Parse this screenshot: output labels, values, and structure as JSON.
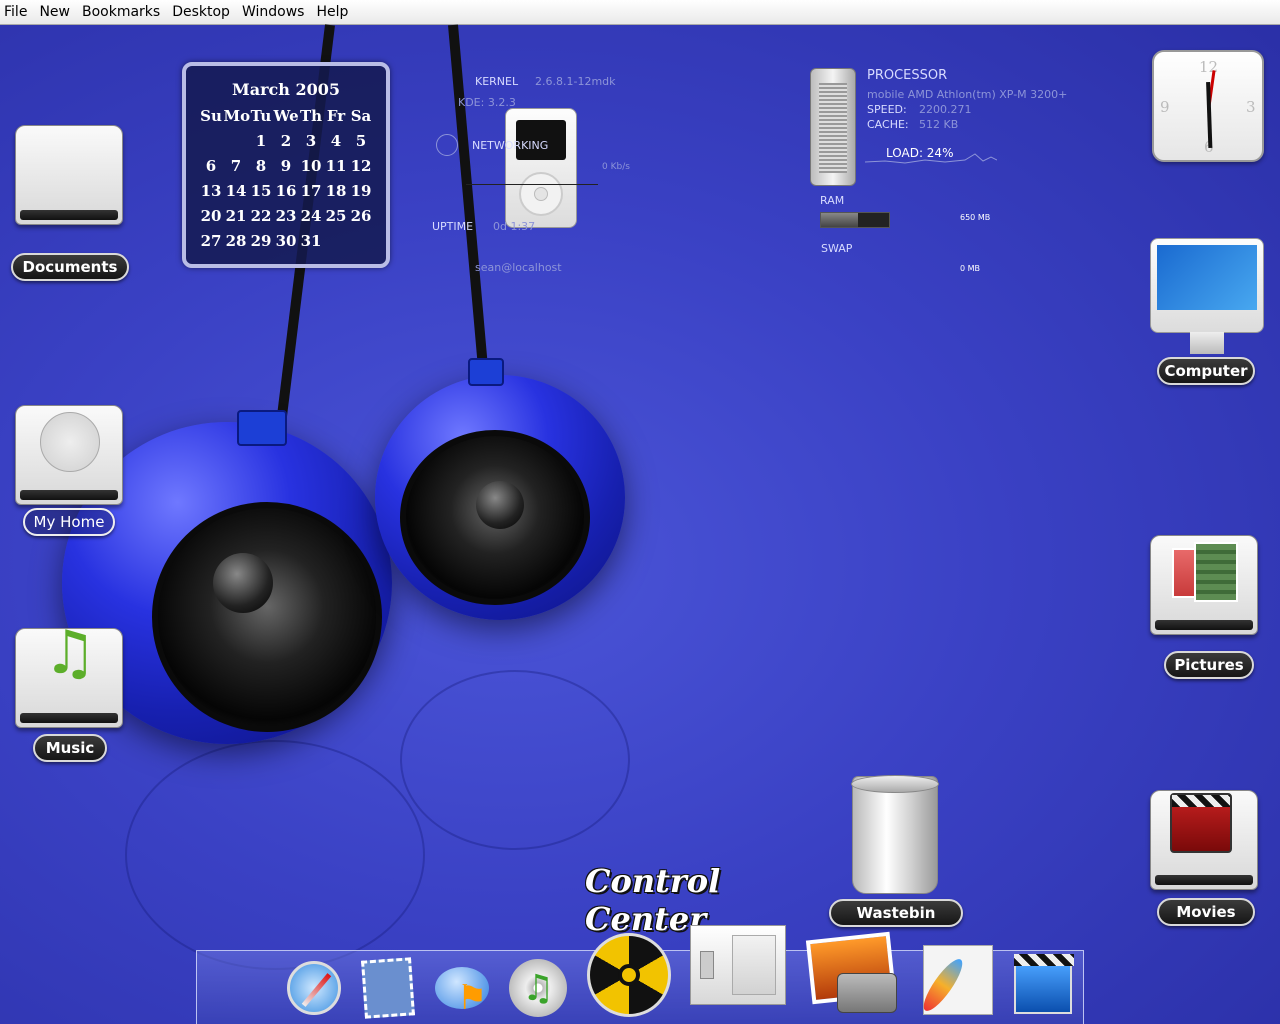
{
  "menubar": {
    "items": [
      "File",
      "New",
      "Bookmarks",
      "Desktop",
      "Windows",
      "Help"
    ]
  },
  "calendar": {
    "title": "March 2005",
    "weekdays": [
      "Su",
      "Mo",
      "Tu",
      "We",
      "Th",
      "Fr",
      "Sa"
    ],
    "rows": [
      [
        "",
        "",
        "1",
        "2",
        "3",
        "4",
        "5"
      ],
      [
        "6",
        "7",
        "8",
        "9",
        "10",
        "11",
        "12"
      ],
      [
        "13",
        "14",
        "15",
        "16",
        "17",
        "18",
        "19"
      ],
      [
        "20",
        "21",
        "22",
        "23",
        "24",
        "25",
        "26"
      ],
      [
        "27",
        "28",
        "29",
        "30",
        "31",
        "",
        ""
      ]
    ]
  },
  "sysmon": {
    "kernel_label": "KERNEL",
    "kernel_value": "2.6.8.1-12mdk",
    "kde": "KDE: 3.2.3",
    "networking_label": "NETWORKING",
    "net_rate": "0 Kb/s",
    "uptime_label": "UPTIME",
    "uptime_value": "0d 1:37",
    "user": "sean@localhost"
  },
  "cpu": {
    "title": "PROCESSOR",
    "model": "mobile AMD Athlon(tm) XP-M 3200+",
    "speed_label": "SPEED:",
    "speed_value": "2200.271",
    "cache_label": "CACHE:",
    "cache_value": "512 KB",
    "load": "LOAD: 24%",
    "ram_label": "RAM",
    "ram_value": "650 MB",
    "ram_fill": 0.55,
    "swap_label": "SWAP",
    "swap_value": "0 MB"
  },
  "desktop_icons": {
    "documents": "Documents",
    "my_home": "My Home",
    "music": "Music",
    "computer": "Computer",
    "pictures": "Pictures",
    "movies": "Movies",
    "wastebin": "Wastebin"
  },
  "control_center": "Control Center",
  "dock": {
    "items": [
      "apple",
      "safari",
      "mail",
      "ichat",
      "itunes",
      "radiation",
      "switch",
      "iphoto",
      "feather",
      "movie"
    ]
  },
  "clock": {
    "n12": "12",
    "n3": "3",
    "n6": "6",
    "n9": "9"
  },
  "colors": {
    "background": "#3a41c4",
    "label_bg": "#1e1e1e"
  }
}
